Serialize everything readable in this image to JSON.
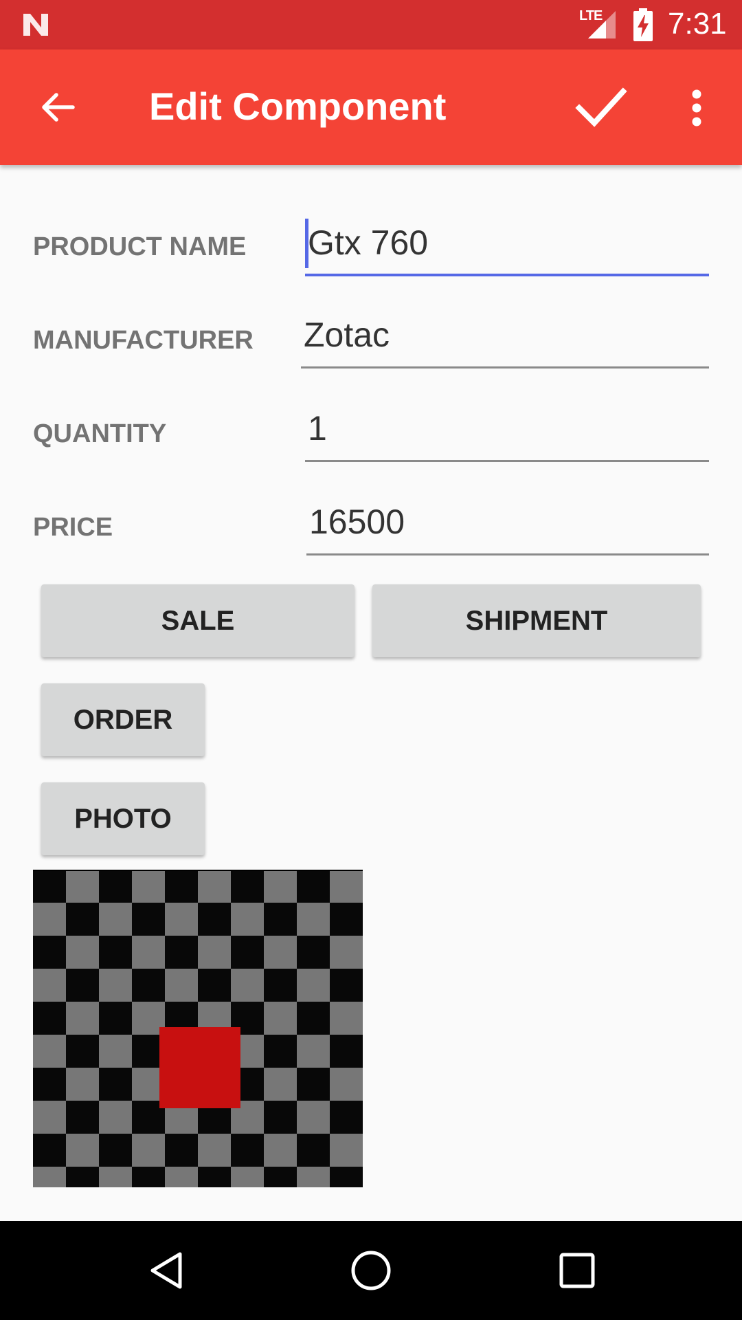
{
  "status_bar": {
    "network": "LTE",
    "time": "7:31",
    "icons": [
      "android-n-icon",
      "signal-icon",
      "battery-charging-icon"
    ]
  },
  "app_bar": {
    "title": "Edit Component",
    "icons": [
      "back-arrow-icon",
      "check-icon",
      "more-vert-icon"
    ]
  },
  "form": {
    "product_name": {
      "label": "PRODUCT NAME",
      "value": "Gtx 760"
    },
    "manufacturer": {
      "label": "MANUFACTURER",
      "value": "Zotac"
    },
    "quantity": {
      "label": "QUANTITY",
      "value": "1"
    },
    "price": {
      "label": "PRICE",
      "value": "16500"
    }
  },
  "buttons": {
    "sale": "SALE",
    "shipment": "SHIPMENT",
    "order": "ORDER",
    "photo": "PHOTO"
  },
  "photo": {
    "icon": "placeholder-image"
  },
  "nav_bar": {
    "icons": [
      "nav-back-icon",
      "nav-home-icon",
      "nav-recents-icon"
    ]
  },
  "colors": {
    "status_bar": "#d32f2f",
    "app_bar": "#f44336",
    "accent": "#5568e6",
    "button": "#d6d7d7",
    "placeholder_red": "#c81010"
  }
}
